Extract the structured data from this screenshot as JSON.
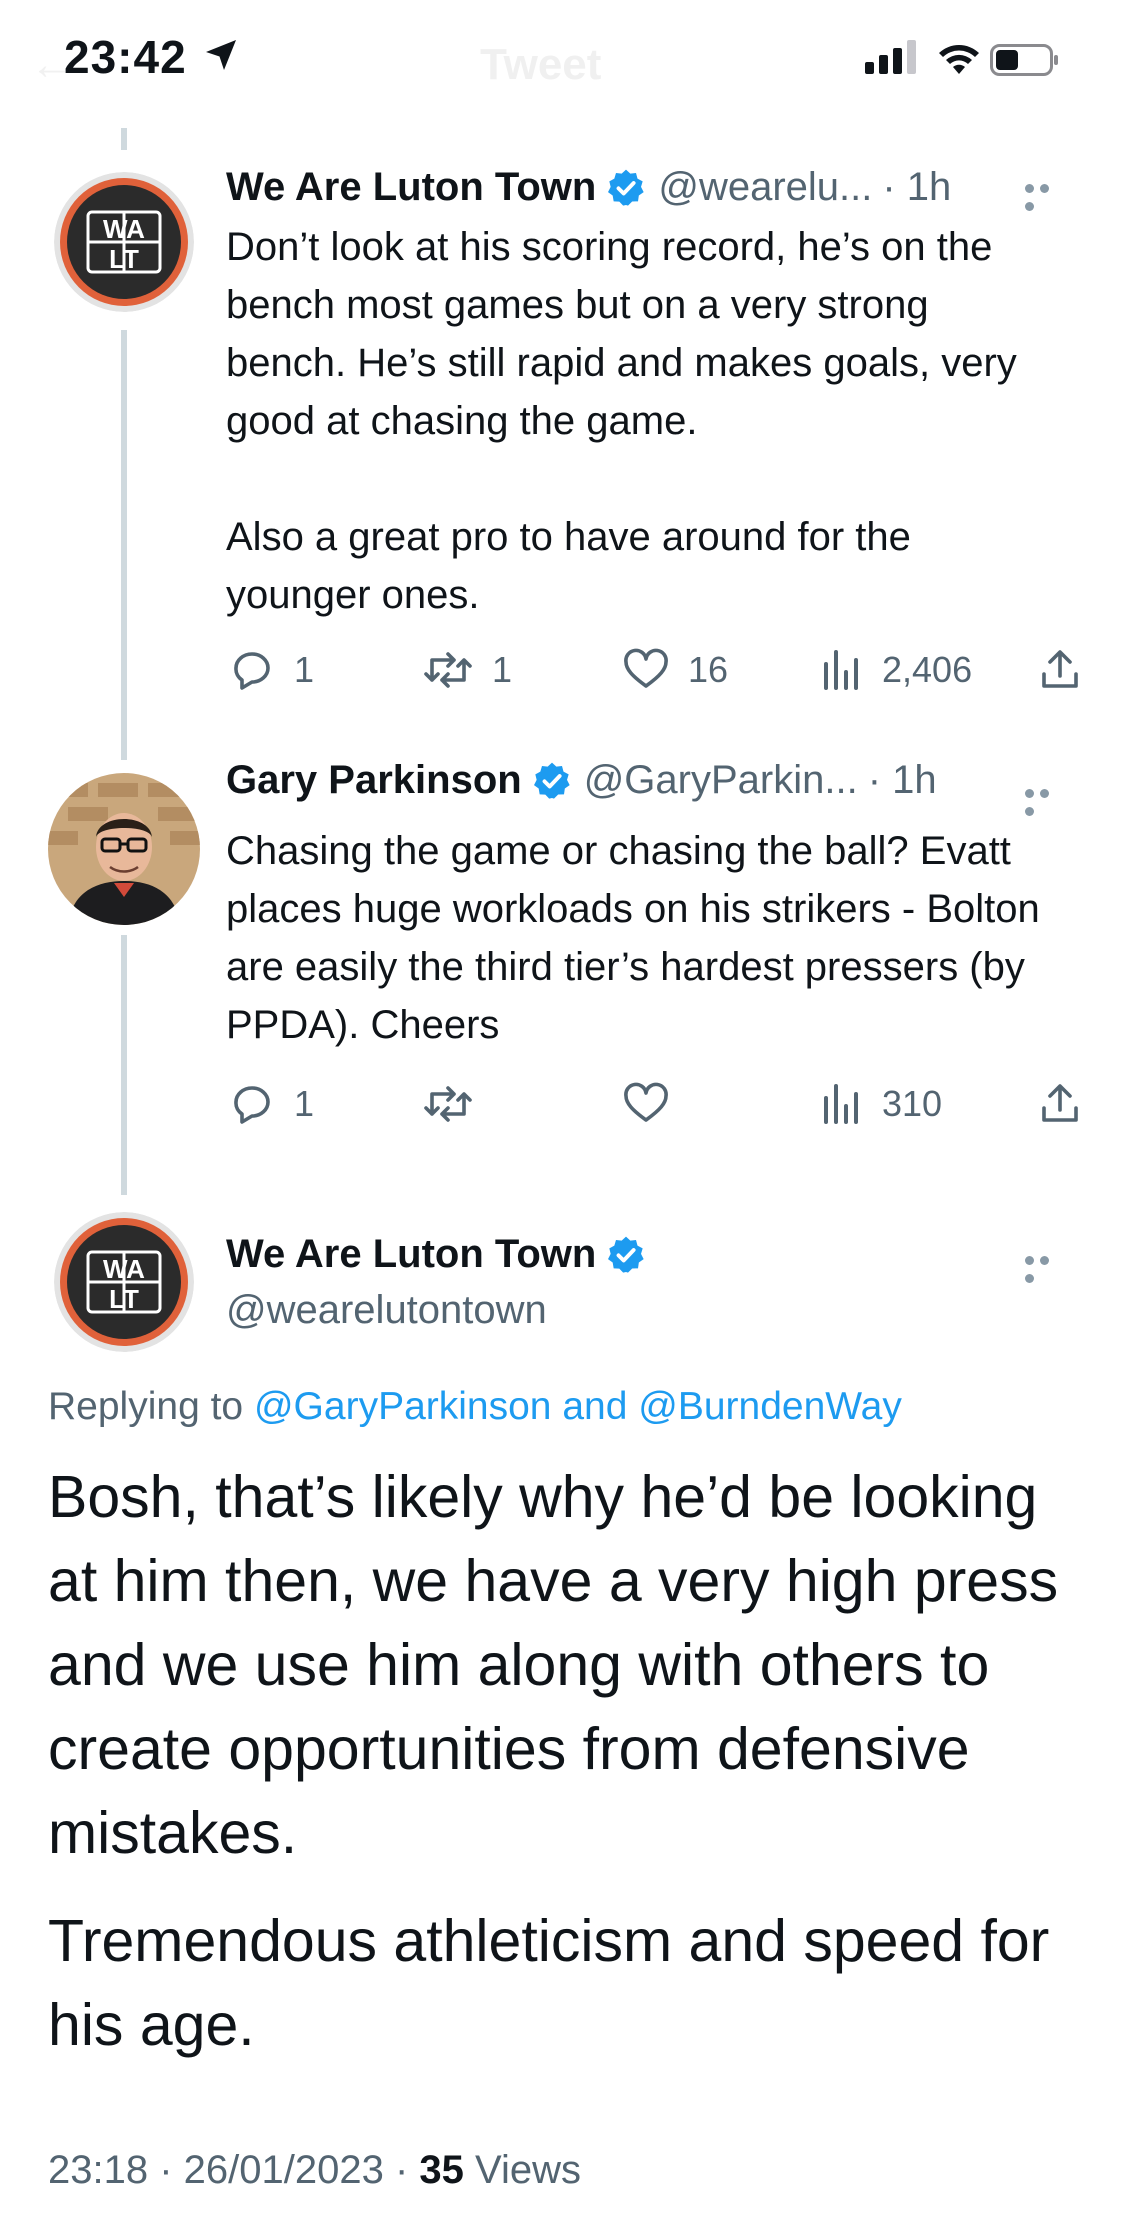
{
  "status": {
    "time": "23:42",
    "ghost_title": "Tweet"
  },
  "tweets": [
    {
      "display_name": "We Are Luton Town",
      "handle": "@wearelu...",
      "time": "· 1h",
      "text_p1": "Don’t look at his scoring record, he’s on the bench most games but on a very strong bench. He’s still rapid and makes goals, very good at chasing the game.",
      "text_p2": "Also a great pro to have around for the younger ones.",
      "replies": "1",
      "retweets": "1",
      "likes": "16",
      "views": "2,406"
    },
    {
      "display_name": "Gary Parkinson",
      "handle": "@GaryParkin...",
      "time": "· 1h",
      "text_p1": "Chasing the game or chasing the ball? Evatt places huge workloads on his strikers - Bolton are easily the third tier’s hardest pressers (by PPDA). Cheers",
      "replies": "1",
      "retweets": "",
      "likes": "",
      "views": "310"
    }
  ],
  "main_tweet": {
    "display_name": "We Are Luton Town",
    "handle": "@wearelutontown",
    "replying_prefix": "Replying to",
    "replying_user1": "@GaryParkinson",
    "replying_and": "and",
    "replying_user2": "@BurndenWay",
    "text_p1": "Bosh, that’s likely why he’d be looking at him then, we have a very high press and we use him along with others to create opportunities from defensive mistakes.",
    "text_p2": "Tremendous athleticism and speed for his age.",
    "timestamp": "23:18 · 26/01/2023 ·",
    "views_count": "35",
    "views_label": "Views"
  },
  "colors": {
    "accent": "#1d9bf0",
    "secondary_text": "#536471",
    "avatar_ring": "#e0613a"
  },
  "icons": [
    "location-arrow-icon",
    "signal-icon",
    "wifi-icon",
    "battery-icon",
    "verified-badge-icon",
    "reply-icon",
    "retweet-icon",
    "like-icon",
    "views-icon",
    "share-icon",
    "more-icon"
  ]
}
